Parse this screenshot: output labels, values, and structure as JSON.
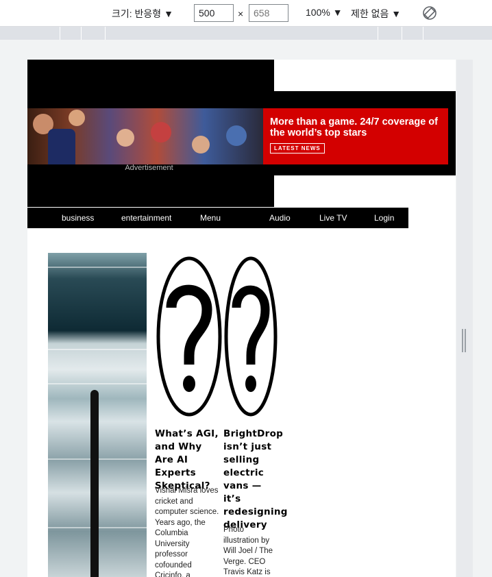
{
  "devtools": {
    "size_label": "크기: 반응형 ▼",
    "width_value": "500",
    "times": "×",
    "height_placeholder": "658",
    "zoom_label": "100% ▼",
    "throttle_label": "제한 없음 ▼",
    "rotate_icon": "rotate-icon"
  },
  "ad": {
    "headline": "More than a game. 24/7 coverage of the world’s top stars",
    "button": "LATEST NEWS",
    "caption": "Advertisement",
    "accent": "#d30000"
  },
  "nav": {
    "items": [
      "business",
      "entertainment",
      "Menu",
      "Audio",
      "Live TV",
      "Login"
    ]
  },
  "cards": [
    {
      "title": "What’s AGI, and Why Are AI Experts Skeptical?",
      "excerpt": "Vishal Misra loves cricket and computer science. Years ago, the Columbia University professor cofounded Cricinfo, a collaborative"
    },
    {
      "title": "BrightDrop isn’t just selling electric vans — it’s redesigning delivery",
      "excerpt": "Photo illustration by Will Joel / The Verge. CEO Travis Katz is"
    }
  ]
}
